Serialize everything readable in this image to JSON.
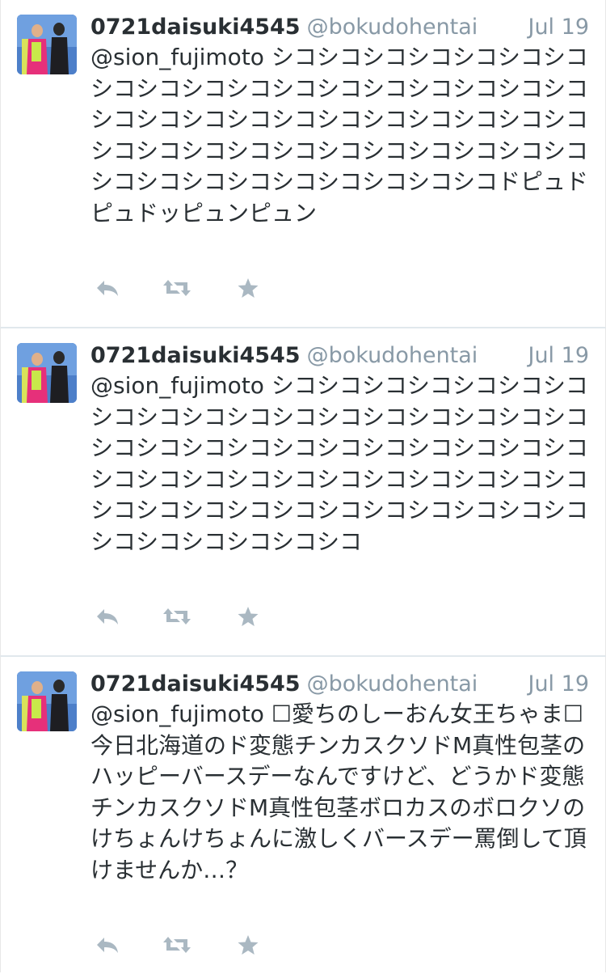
{
  "tweets": [
    {
      "display_name": "0721daisuki4545",
      "handle": "@bokudohentai",
      "timestamp": "Jul 19",
      "text": "@sion_fujimoto シコシコシコシコシコシコシコシコシコシコシコシコシコシコシコシコシコシコシコシコシコシコシコシコシコシコシコシコシコシコシコシコシコシコシコシコシコシコシコシコシコシコシコシコシコシコシコシコシコドピュドピュドッピュンピュン"
    },
    {
      "display_name": "0721daisuki4545",
      "handle": "@bokudohentai",
      "timestamp": "Jul 19",
      "text": "@sion_fujimoto シコシコシコシコシコシコシコシコシコシコシコシコシコシコシコシコシコシコシコシコシコシコシコシコシコシコシコシコシコシコシコシコシコシコシコシコシコシコシコシコシコシコシコシコシコシコシコシコシコシコシコシコシコシコシコシコシコ"
    },
    {
      "display_name": "0721daisuki4545",
      "handle": "@bokudohentai",
      "timestamp": "Jul 19",
      "text": "@sion_fujimoto ☐愛ちのしーおん女王ちゃま☐ 今日北海道のド変態チンカスクソドM真性包茎のハッピーバースデーなんですけど、どうかド変態チンカスクソドM真性包茎ボロカスのボロクソのけちょんけちょんに激しくバースデー罵倒して頂けませんか…？"
    }
  ],
  "icons": {
    "reply": "reply-icon",
    "retweet": "retweet-icon",
    "favorite": "star-icon"
  },
  "colors": {
    "name": "#292f33",
    "handle": "#8899a6",
    "action_icon": "#aab8c2",
    "divider": "#e1e8ed"
  }
}
